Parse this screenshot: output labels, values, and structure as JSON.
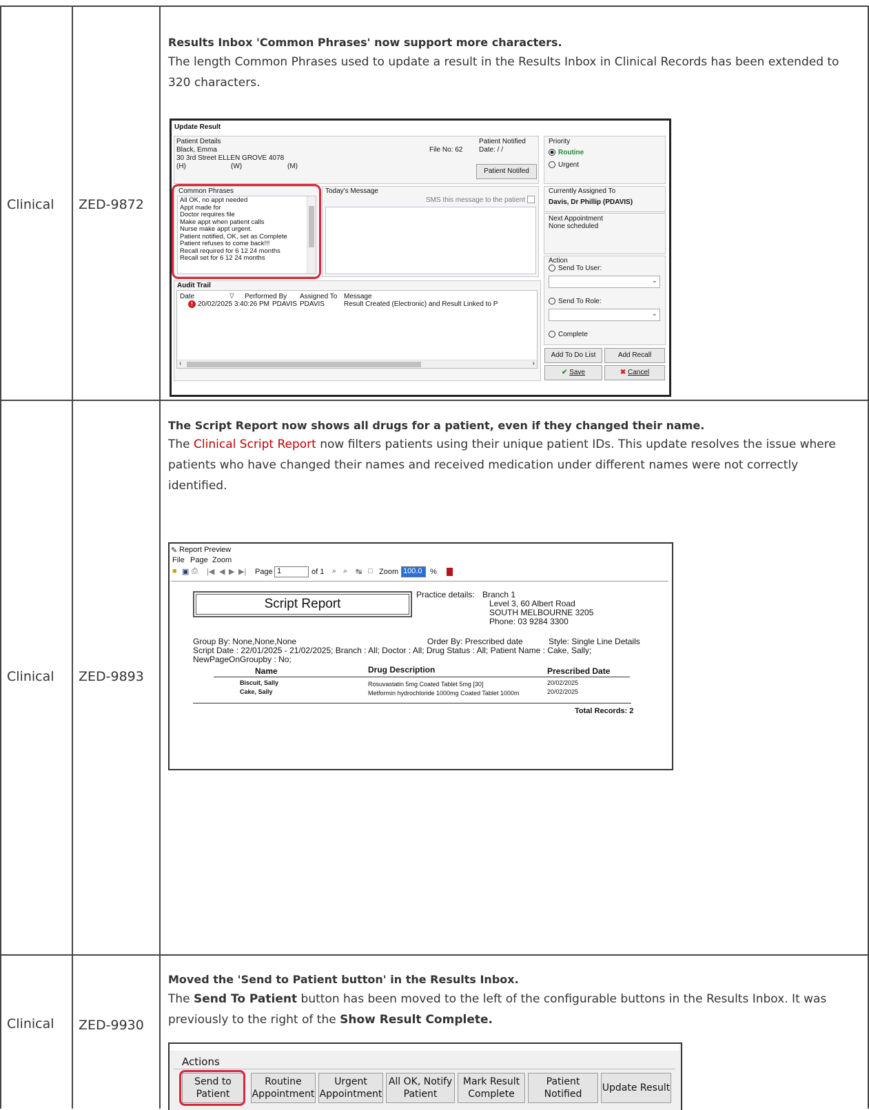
{
  "rows": [
    {
      "category": "Clinical",
      "ticket": "ZED-9872",
      "title": "Results Inbox 'Common Phrases' now support more characters.",
      "description": "The length Common Phrases used to update a result in the Results Inbox in Clinical Records has been extended to 320 characters."
    },
    {
      "category": "Clinical",
      "ticket": "ZED-9893",
      "title": "The Script Report now shows all drugs for a patient, even if they changed their name.",
      "desc_pre": "The ",
      "desc_link": "Clinical Script Report",
      "desc_post": " now filters patients using their unique patient IDs. This update resolves the issue where patients who have changed their names and received medication under different names were not correctly identified."
    },
    {
      "category": "Clinical",
      "ticket": "ZED-9930",
      "title": "Moved the 'Send to Patient button' in the Results Inbox.",
      "desc_1": "The ",
      "desc_b1": "Send To Patient",
      "desc_2": " button has been moved to the left of the configurable buttons in the Results Inbox. It was previously to the right of the ",
      "desc_b2": "Show Result Complete."
    }
  ],
  "update_result": {
    "window_title": "Update Result",
    "patient_details_label": "Patient Details",
    "patient_name": "Black, Emma",
    "address": "30 3rd Street  ELLEN GROVE  4078",
    "phone_h": "(H)",
    "phone_w": "(W)",
    "phone_m": "(M)",
    "file_no": "File No: 62",
    "patient_notified_label": "Patient Notified",
    "date_label": "Date:  / /",
    "patient_notified_button": "Patient Notifed",
    "priority_label": "Priority",
    "priority_routine": "Routine",
    "priority_urgent": "Urgent",
    "common_phrases_label": "Common Phrases",
    "phrases": [
      "All OK, no appt needed",
      "Appt made for",
      "Doctor requires file",
      "Make appt when patient calls",
      "Nurse make appt urgent.",
      "Patient notified, OK, set as Complete",
      "Patient refuses to come back!!!",
      "Recall required for 6  12  24  months",
      "Recall set for 6 12 24 months"
    ],
    "todays_message_label": "Today's Message",
    "sms_label": "SMS this message to the patient",
    "currently_assigned_label": "Currently Assigned To",
    "currently_assigned_value": "Davis, Dr Phillip (PDAVIS)",
    "next_appointment_label": "Next Appointment",
    "next_appointment_value": "None scheduled",
    "action_label": "Action",
    "send_to_user": "Send To User:",
    "send_to_role": "Send To Role:",
    "complete": "Complete",
    "add_to_do_list": "Add To Do List",
    "add_recall": "Add Recall",
    "save": "Save",
    "cancel": "Cancel",
    "audit_trail_label": "Audit Trail",
    "audit_columns": [
      "Date",
      "Performed By",
      "Assigned To",
      "Message"
    ],
    "audit_row": [
      "20/02/2025 3:40:26 PM",
      "PDAVIS",
      "PDAVIS",
      "Result Created (Electronic) and Result Linked to P"
    ]
  },
  "report_preview": {
    "window_title": "Report Preview",
    "menu": [
      "File",
      "Page",
      "Zoom"
    ],
    "page_label": "Page",
    "page_value": "1",
    "of_label": "of 1",
    "zoom_label": "Zoom",
    "zoom_value": "100.0",
    "percent": "%",
    "report_title": "Script Report",
    "practice_label": "Practice details:",
    "practice_lines": [
      "Branch 1",
      "Level 3, 60 Albert Road",
      "SOUTH  MELBOURNE  3205",
      "Phone:  03  9284  3300"
    ],
    "group_by": "Group By:  None,None,None",
    "order_by": "Order By:  Prescribed date",
    "style": "Style: Single Line Details",
    "filter_line1": "Script Date  :  22/01/2025 - 21/02/2025;  Branch  :  All;  Doctor  :  All;  Drug Status  :  All;  Patient Name  :  Cake, Sally;",
    "filter_line2": "NewPageOnGroupby  :  No;",
    "columns": [
      "Name",
      "Drug Description",
      "Prescribed Date"
    ],
    "rows": [
      [
        "Biscuit, Sally",
        "Rosuvastatin 5mg Coated Tablet 5mg [30]",
        "20/02/2025"
      ],
      [
        "Cake, Sally",
        "Metformin hydrochloride 1000mg Coated Tablet 1000m",
        "20/02/2025"
      ]
    ],
    "total": "Total Records: 2"
  },
  "actions_bar": {
    "label": "Actions",
    "buttons": [
      [
        "Send to",
        "Patient"
      ],
      [
        "Routine",
        "Appointment"
      ],
      [
        "Urgent",
        "Appointment"
      ],
      [
        "All OK, Notify",
        "Patient"
      ],
      [
        "Mark Result",
        "Complete"
      ],
      [
        "Patient",
        "Notified"
      ],
      [
        "Update Result",
        ""
      ]
    ]
  },
  "colors": {
    "highlight": "#d9263f",
    "link": "#c00000",
    "routine_green": "#1e8e2e",
    "zoom_selected": "#2b6fd6"
  }
}
